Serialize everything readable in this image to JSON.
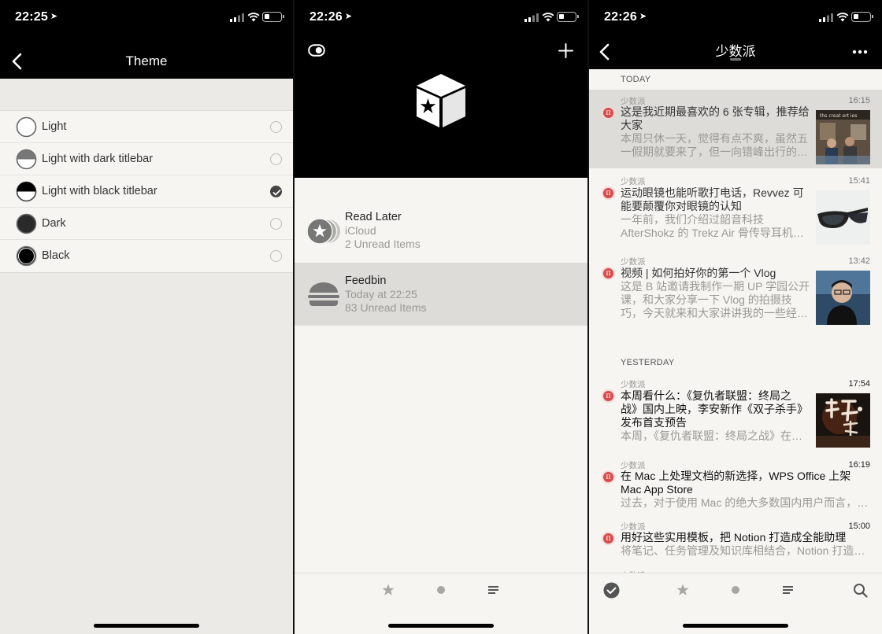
{
  "panel_theme": {
    "status_time": "22:25",
    "title": "Theme",
    "options": [
      {
        "label": "Light",
        "selected": false
      },
      {
        "label": "Light with dark titlebar",
        "selected": false
      },
      {
        "label": "Light with black titlebar",
        "selected": true
      },
      {
        "label": "Dark",
        "selected": false
      },
      {
        "label": "Black",
        "selected": false
      }
    ]
  },
  "panel_accounts": {
    "status_time": "22:26",
    "accounts": [
      {
        "name": "Read Later",
        "line2": "iCloud",
        "line3": "2 Unread Items",
        "icon": "star-stack-icon"
      },
      {
        "name": "Feedbin",
        "line2": "Today at 22:25",
        "line3": "83 Unread Items",
        "icon": "burger-icon"
      }
    ],
    "tabs": [
      "star-icon",
      "dot-icon",
      "list-icon"
    ]
  },
  "panel_feed": {
    "status_time": "22:26",
    "title": "少数派",
    "sections": [
      {
        "label": "TODAY",
        "articles": [
          {
            "source": "少数派",
            "time": "16:15",
            "title_lines": [
              "这是我近期最喜欢的 6 张专辑，推荐给",
              "大家"
            ],
            "summary_lines": [
              "本周只休一天，觉得有点不爽，虽然五",
              "一假期就要来了，但一向错峰出行的…"
            ]
          },
          {
            "source": "少数派",
            "time": "15:41",
            "title_lines": [
              "运动眼镜也能听歌打电话，Revvez 可",
              "能要颠覆你对眼镜的认知"
            ],
            "summary_lines": [
              "一年前，我们介绍过韶音科技",
              "AfterShokz 的 Trekz Air 骨传导耳机…"
            ]
          },
          {
            "source": "少数派",
            "time": "13:42",
            "title_lines": [
              "视频 | 如何拍好你的第一个 Vlog"
            ],
            "summary_lines": [
              "这是 B 站邀请我制作一期 UP 学园公开",
              "课，和大家分享一下 Vlog 的拍摄技",
              "巧，今天就来和大家讲讲我的一些经…"
            ]
          }
        ]
      },
      {
        "label": "YESTERDAY",
        "articles": [
          {
            "source": "少数派",
            "time": "17:54",
            "title_lines": [
              "本周看什么：《复仇者联盟：终局之",
              "战》国内上映，李安新作《双子杀手》",
              "发布首支预告"
            ],
            "summary_lines": [
              "本周，《复仇者联盟：终局之战》在…"
            ]
          },
          {
            "source": "少数派",
            "time": "16:19",
            "title_lines": [
              "在 Mac 上处理文档的新选择，WPS Office 上架",
              "Mac App Store"
            ],
            "summary_lines": [
              "过去，对于使用 Mac 的绝大多数国内用户而言，…"
            ]
          },
          {
            "source": "少数派",
            "time": "15:00",
            "title_lines": [
              "用好这些实用模板，把 Notion 打造成全能助理"
            ],
            "summary_lines": [
              "将笔记、任务管理及知识库相结合，Notion 打造…"
            ]
          },
          {
            "source": "少数派",
            "time": "",
            "title_lines": [],
            "summary_lines": []
          }
        ]
      }
    ],
    "tabs": [
      "check-icon",
      "star-icon",
      "dot-icon",
      "list-icon",
      "search-icon"
    ]
  }
}
